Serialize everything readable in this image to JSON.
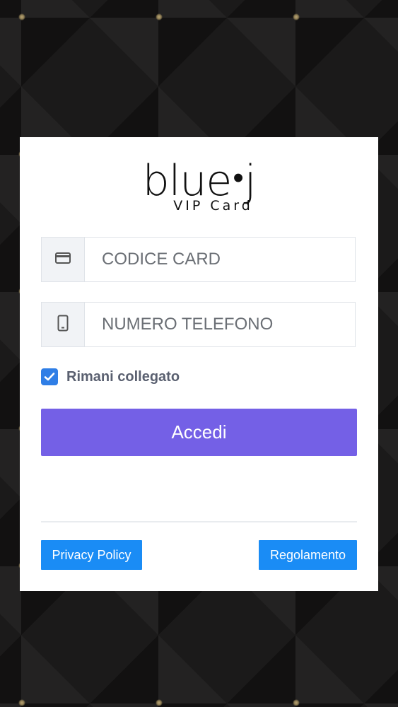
{
  "brand": {
    "logo_main": "blue",
    "logo_dot": "•",
    "logo_end": "j",
    "logo_sub": "VIP Card"
  },
  "form": {
    "card_field": {
      "placeholder": "CODICE CARD",
      "icon": "credit-card-icon"
    },
    "phone_field": {
      "placeholder": "NUMERO TELEFONO",
      "icon": "mobile-phone-icon"
    },
    "remember": {
      "label": "Rimani collegato",
      "checked": true
    },
    "submit_label": "Accedi"
  },
  "footer": {
    "privacy_label": "Privacy Policy",
    "rules_label": "Regolamento"
  },
  "colors": {
    "primary": "#7460e6",
    "link_button": "#1a8cf5",
    "checkbox": "#2f7ee6",
    "background": "#1b1a1a"
  }
}
